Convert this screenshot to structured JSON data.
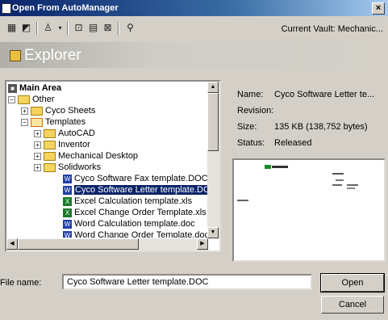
{
  "window": {
    "title": "Open From AutoManager",
    "close": "×"
  },
  "toolbar": {
    "icons": [
      "details-view-icon",
      "workflow-icon",
      "user-icon",
      "new-folder-icon",
      "properties-icon",
      "delete-icon",
      "binoculars-icon"
    ],
    "vault": "Current Vault: Mechanic..."
  },
  "explorer": {
    "title": "Explorer"
  },
  "tree": {
    "items": [
      {
        "label": "Main Area",
        "kind": "root"
      },
      {
        "label": "Other",
        "kind": "node"
      },
      {
        "label": "Cyco Sheets",
        "kind": "folder"
      },
      {
        "label": "Templates",
        "kind": "open-folder"
      },
      {
        "label": "AutoCAD",
        "kind": "folder"
      },
      {
        "label": "Inventor",
        "kind": "folder"
      },
      {
        "label": "Mechanical Desktop",
        "kind": "folder"
      },
      {
        "label": "Solidworks",
        "kind": "folder"
      },
      {
        "label": "Cyco Software Fax template.DOC",
        "kind": "doc"
      },
      {
        "label": "Cyco Software Letter template.DOC",
        "kind": "doc",
        "selected": true
      },
      {
        "label": "Excel Calculation template.xls",
        "kind": "xls"
      },
      {
        "label": "Excel Change Order Template.xls",
        "kind": "xls"
      },
      {
        "label": "Word Calculation template.doc",
        "kind": "doc"
      },
      {
        "label": "Word Change Order Template.doc",
        "kind": "doc"
      }
    ]
  },
  "properties": {
    "name_label": "Name:",
    "name_value": "Cyco Software Letter te...",
    "revision_label": "Revision:",
    "revision_value": "",
    "size_label": "Size:",
    "size_value": "135 KB (138,752 bytes)",
    "status_label": "Status:",
    "status_value": "Released"
  },
  "file": {
    "label": "File name:",
    "value": "Cyco Software Letter template.DOC"
  },
  "buttons": {
    "open": "Open",
    "cancel": "Cancel"
  },
  "colors": {
    "selection": "#0a246a",
    "title_bar": "#0a246a",
    "dialog_bg": "#d4d0c8"
  }
}
